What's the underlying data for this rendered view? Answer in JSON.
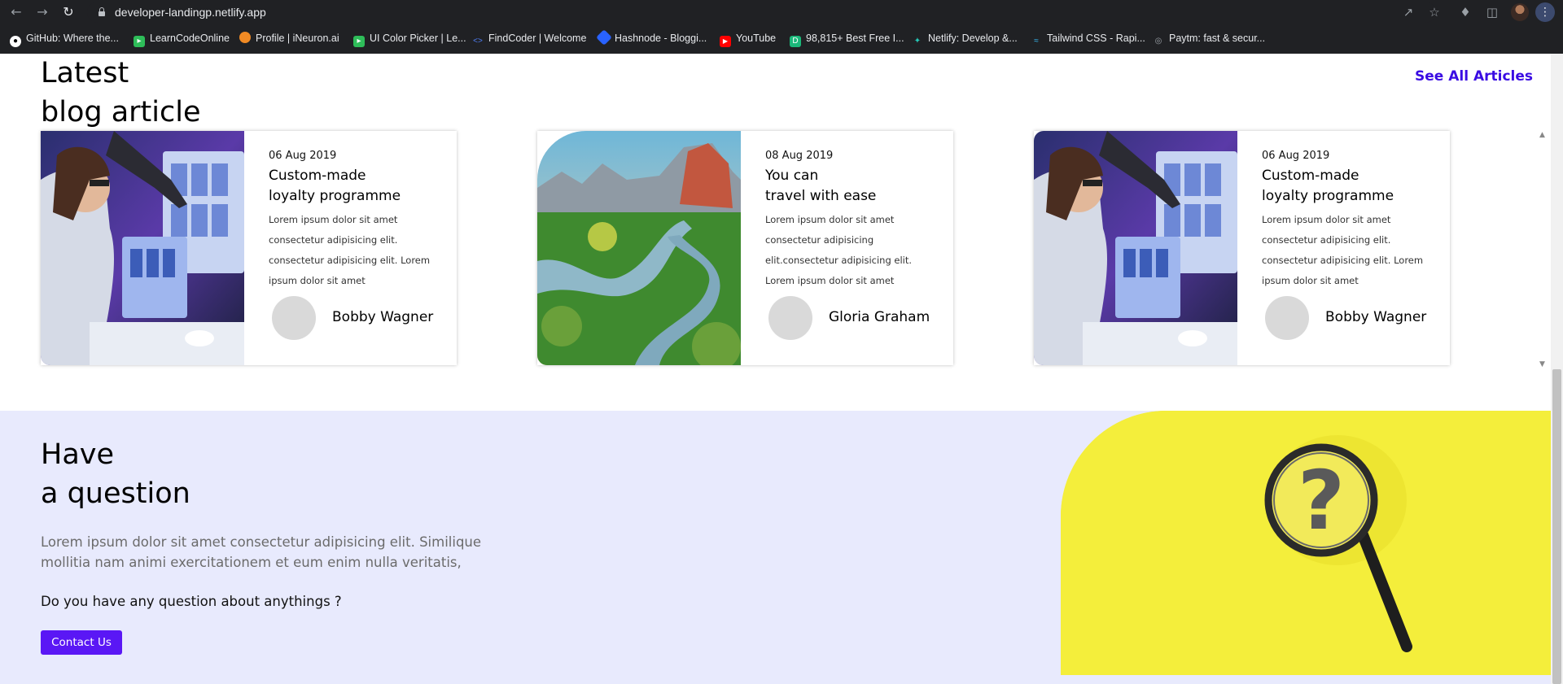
{
  "browser": {
    "url": "developer-landingp.netlify.app",
    "bookmarks": [
      {
        "label": "GitHub: Where the...",
        "icon": "github-icon",
        "color": "#ffffff"
      },
      {
        "label": "LearnCodeOnline",
        "icon": "learncodeonline-icon",
        "color": "#2ebd59"
      },
      {
        "label": "Profile | iNeuron.ai",
        "icon": "ineuron-icon",
        "color": "#f08a24"
      },
      {
        "label": "UI Color Picker | Le...",
        "icon": "ui-color-picker-icon",
        "color": "#2ebd59"
      },
      {
        "label": "FindCoder | Welcome",
        "icon": "findcoder-icon",
        "color": "#4f7df3"
      },
      {
        "label": "Hashnode - Bloggi...",
        "icon": "hashnode-icon",
        "color": "#2962ff"
      },
      {
        "label": "YouTube",
        "icon": "youtube-icon",
        "color": "#ff0000"
      },
      {
        "label": "98,815+ Best Free I...",
        "icon": "freepik-icon",
        "color": "#1bb87a"
      },
      {
        "label": "Netlify: Develop &...",
        "icon": "netlify-icon",
        "color": "#25c7b7"
      },
      {
        "label": "Tailwind CSS - Rapi...",
        "icon": "tailwind-icon",
        "color": "#38bdf8"
      },
      {
        "label": "Paytm: fast & secur...",
        "icon": "globe-icon",
        "color": "#9aa0a6"
      }
    ]
  },
  "blog": {
    "title_line1": "Latest",
    "title_line2": "blog article",
    "see_all": "See All Articles",
    "cards": [
      {
        "date": "06 Aug 2019",
        "title_line1": "Custom-made",
        "title_line2": "loyalty programme",
        "text": "Lorem ipsum dolor sit amet consectetur adipisicing elit. consectetur adipisicing elit. Lorem ipsum dolor sit amet",
        "author": "Bobby Wagner",
        "image": "woman-at-computer"
      },
      {
        "date": "08 Aug 2019",
        "title_line1": "You can",
        "title_line2": "travel with ease",
        "text": "Lorem ipsum dolor sit amet consectetur adipisicing elit.consectetur adipisicing elit. Lorem ipsum dolor sit amet",
        "author": "Gloria Graham",
        "image": "river-landscape"
      },
      {
        "date": "06 Aug 2019",
        "title_line1": "Custom-made",
        "title_line2": "loyalty programme",
        "text": "Lorem ipsum dolor sit amet consectetur adipisicing elit. consectetur adipisicing elit. Lorem ipsum dolor sit amet",
        "author": "Bobby Wagner",
        "image": "woman-at-computer"
      }
    ]
  },
  "question": {
    "title_line1": "Have",
    "title_line2": "a question",
    "text": "Lorem ipsum dolor sit amet consectetur adipisicing elit. Similique mollitia nam animi exercitationem et eum enim nulla veritatis,",
    "ask": "Do you have any question about anythings ?",
    "button": "Contact Us"
  },
  "colors": {
    "accent": "#5a17f5",
    "link": "#3a0ce3",
    "question_bg": "#e8eafd",
    "yellow": "#f4ee3b"
  }
}
